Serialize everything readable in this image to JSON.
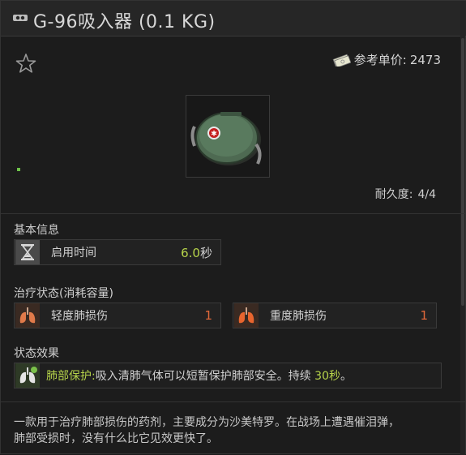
{
  "window": {
    "title": "G-96吸入器 (0.1 KG)"
  },
  "header": {
    "price_label": "参考单价:",
    "price_value": "2473"
  },
  "durability": {
    "label": "耐久度:",
    "value": "4/4"
  },
  "basic_info": {
    "title": "基本信息",
    "stats": [
      {
        "label": "启用时间",
        "value": "6.0",
        "unit": "秒",
        "icon": "hourglass-icon"
      }
    ]
  },
  "treatment": {
    "title": "治疗状态(消耗容量)",
    "stats": [
      {
        "label": "轻度肺损伤",
        "value": "1",
        "icon": "lungs-icon"
      },
      {
        "label": "重度肺损伤",
        "value": "1",
        "icon": "lungs-icon"
      }
    ]
  },
  "effects": {
    "title": "状态效果",
    "items": [
      {
        "name": "肺部保护:",
        "text": "吸入清肺气体可以短暂保护肺部安全。持续",
        "duration": "30秒",
        "end": "。",
        "icon": "lungs-shield-icon"
      }
    ]
  },
  "description": {
    "line1": "一款用于治疗肺部损伤的药剂，主要成分为沙美特罗。在战场上遭遇催泪弹，",
    "line2": "肺部受损时，没有什么比它见效更快了。"
  },
  "colors": {
    "accent_green": "#b6d34a",
    "accent_orange": "#e0683a",
    "background": "#1c1c1c"
  }
}
